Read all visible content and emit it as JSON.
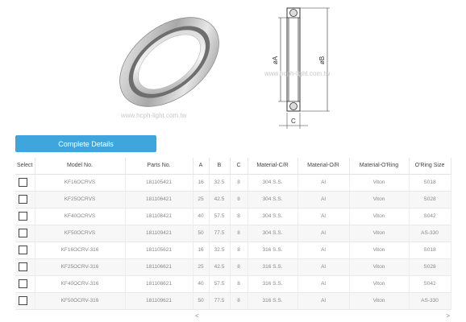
{
  "figures": {
    "watermark": "www.hcph-light.com.tw",
    "dimension_labels": {
      "a": "øA",
      "b": "øB",
      "c": "C"
    }
  },
  "actions": {
    "complete_details_label": "Complete Details"
  },
  "table": {
    "headers": [
      "Select",
      "Model No.",
      "Parts No.",
      "A",
      "B",
      "C",
      "Material-C/R",
      "Material-O/R",
      "Material-O'Ring",
      "O'Ring Size"
    ],
    "rows": [
      [
        "KF16OCRVS",
        "181105421",
        "16",
        "32.5",
        "8",
        "304 S.S.",
        "Al",
        "Viton",
        "S018"
      ],
      [
        "KF25OCRVS",
        "181106421",
        "25",
        "42.5",
        "8",
        "304 S.S.",
        "Al",
        "Viton",
        "S028"
      ],
      [
        "KF40OCRVS",
        "181108421",
        "40",
        "57.5",
        "8",
        "304 S.S.",
        "Al",
        "Viton",
        "S042"
      ],
      [
        "KF50OCRVS",
        "181109421",
        "50",
        "77.5",
        "8",
        "304 S.S.",
        "Al",
        "Viton",
        "AS-330"
      ],
      [
        "KF16OCRV-316",
        "181105621",
        "16",
        "32.5",
        "8",
        "316 S.S.",
        "Al",
        "Viton",
        "S018"
      ],
      [
        "KF25OCRV-316",
        "181106621",
        "25",
        "42.5",
        "8",
        "316 S.S.",
        "Al",
        "Viton",
        "S028"
      ],
      [
        "KF40OCRV-316",
        "181108621",
        "40",
        "57.5",
        "8",
        "316 S.S.",
        "Al",
        "Viton",
        "S042"
      ],
      [
        "KF50OCRV-316",
        "181109621",
        "50",
        "77.5",
        "8",
        "316 S.S.",
        "Al",
        "Viton",
        "AS-330"
      ]
    ]
  },
  "scrollbar": {
    "left_arrow": "<",
    "right_arrow": ">"
  }
}
